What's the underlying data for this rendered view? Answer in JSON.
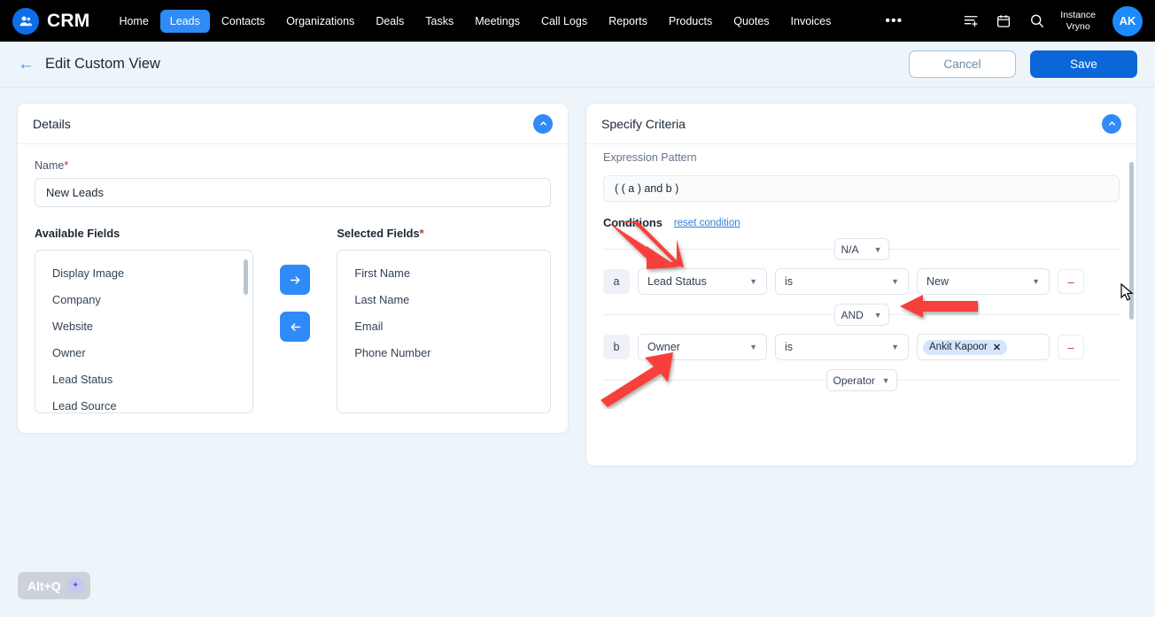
{
  "navbar": {
    "brand": "CRM",
    "brand_icon": "contacts-people-icon",
    "links": [
      {
        "label": "Home",
        "active": false
      },
      {
        "label": "Leads",
        "active": true
      },
      {
        "label": "Contacts",
        "active": false
      },
      {
        "label": "Organizations",
        "active": false
      },
      {
        "label": "Deals",
        "active": false
      },
      {
        "label": "Tasks",
        "active": false
      },
      {
        "label": "Meetings",
        "active": false
      },
      {
        "label": "Call Logs",
        "active": false
      },
      {
        "label": "Reports",
        "active": false
      },
      {
        "label": "Products",
        "active": false
      },
      {
        "label": "Quotes",
        "active": false
      },
      {
        "label": "Invoices",
        "active": false
      }
    ],
    "more": "•••",
    "icons": [
      "list-add-icon",
      "calendar-icon",
      "search-icon"
    ],
    "instance_label": "Instance",
    "instance_name": "Vryno",
    "avatar_initials": "AK",
    "accent": "#2f8bf7"
  },
  "subheader": {
    "back_icon": "arrow-left-icon",
    "title": "Edit Custom View",
    "cancel_label": "Cancel",
    "save_label": "Save",
    "save_color": "#0b66d8"
  },
  "details": {
    "panel_title": "Details",
    "collapse_icon": "chevron-up-icon",
    "name_label": "Name",
    "name_required": "*",
    "name_value": "New Leads",
    "name_placeholder": "Name",
    "available_label": "Available Fields",
    "selected_label": "Selected Fields",
    "selected_required": "*",
    "available_fields": [
      "Display Image",
      "Company",
      "Website",
      "Owner",
      "Lead Status",
      "Lead Source"
    ],
    "selected_fields": [
      "First Name",
      "Last Name",
      "Email",
      "Phone Number"
    ],
    "move_right_icon": "arrow-right-icon",
    "move_left_icon": "arrow-left-icon"
  },
  "criteria": {
    "panel_title": "Specify Criteria",
    "collapse_icon": "chevron-up-icon",
    "expression_label": "Expression Pattern",
    "expression_value": "( ( a ) and b )",
    "conditions_label": "Conditions",
    "reset_label": "reset condition",
    "top_joiner": "N/A",
    "middle_joiner": "AND",
    "bottom_joiner": "Operator",
    "rows": [
      {
        "key": "a",
        "field": "Lead Status",
        "operator": "is",
        "value": "New",
        "value_type": "select",
        "remove_label": "–"
      },
      {
        "key": "b",
        "field": "Owner",
        "operator": "is",
        "value": "Ankit  Kapoor",
        "value_type": "chip",
        "chip_remove_icon": "close-icon",
        "remove_label": "–"
      }
    ]
  },
  "annotations": {
    "arrow_color": "#f7413a",
    "arrows": [
      {
        "name": "arrow-to-lead-status-field",
        "direction": "down-right"
      },
      {
        "name": "arrow-to-and-joiner",
        "direction": "left"
      },
      {
        "name": "arrow-to-owner-field",
        "direction": "up-right"
      }
    ]
  },
  "assistant": {
    "shortcut_label": "Alt+Q",
    "icon": "sparkle-icon"
  }
}
